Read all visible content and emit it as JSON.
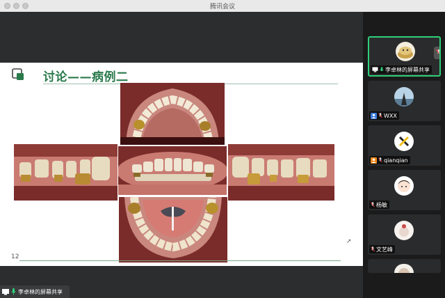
{
  "window": {
    "title": "腾讯会议"
  },
  "slide": {
    "title": "讨论——病例二",
    "page_number": "12",
    "photos": [
      {
        "name": "upper-occlusal-photo"
      },
      {
        "name": "right-lateral-photo"
      },
      {
        "name": "frontal-photo"
      },
      {
        "name": "left-lateral-photo"
      },
      {
        "name": "lower-occlusal-photo"
      }
    ]
  },
  "share_badge": {
    "label": "李卓林的屏幕共享"
  },
  "participants": [
    {
      "name": "李卓林的屏幕共享",
      "sharing": true,
      "active": true
    },
    {
      "name": "WXX",
      "sharing": false,
      "active": false
    },
    {
      "name": "qianqian",
      "sharing": false,
      "active": false
    },
    {
      "name": "杨敏",
      "sharing": false,
      "active": false
    },
    {
      "name": "文艺峰",
      "sharing": false,
      "active": false
    }
  ],
  "colors": {
    "brand_green": "#2a7a4c",
    "active_border": "#2fd07a",
    "mic_green": "#2fd07a",
    "mic_muted": "#e23b3b"
  }
}
